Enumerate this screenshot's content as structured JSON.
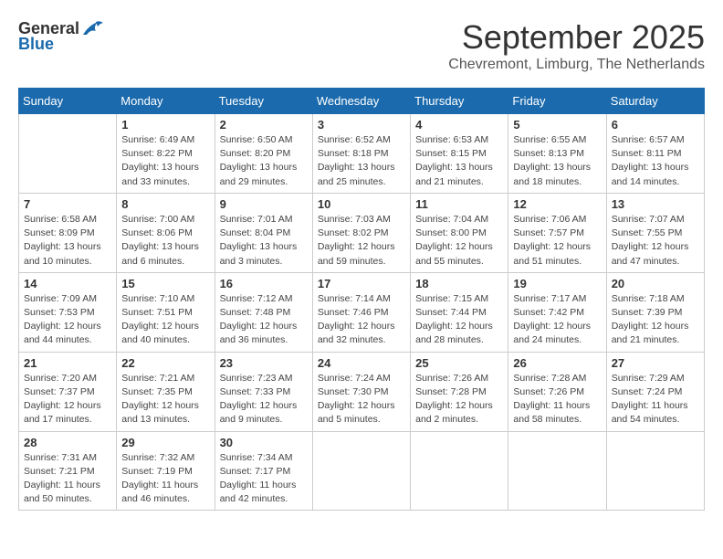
{
  "header": {
    "logo_general": "General",
    "logo_blue": "Blue",
    "title": "September 2025",
    "subtitle": "Chevremont, Limburg, The Netherlands"
  },
  "columns": [
    "Sunday",
    "Monday",
    "Tuesday",
    "Wednesday",
    "Thursday",
    "Friday",
    "Saturday"
  ],
  "weeks": [
    [
      {
        "day": "",
        "info": ""
      },
      {
        "day": "1",
        "info": "Sunrise: 6:49 AM\nSunset: 8:22 PM\nDaylight: 13 hours\nand 33 minutes."
      },
      {
        "day": "2",
        "info": "Sunrise: 6:50 AM\nSunset: 8:20 PM\nDaylight: 13 hours\nand 29 minutes."
      },
      {
        "day": "3",
        "info": "Sunrise: 6:52 AM\nSunset: 8:18 PM\nDaylight: 13 hours\nand 25 minutes."
      },
      {
        "day": "4",
        "info": "Sunrise: 6:53 AM\nSunset: 8:15 PM\nDaylight: 13 hours\nand 21 minutes."
      },
      {
        "day": "5",
        "info": "Sunrise: 6:55 AM\nSunset: 8:13 PM\nDaylight: 13 hours\nand 18 minutes."
      },
      {
        "day": "6",
        "info": "Sunrise: 6:57 AM\nSunset: 8:11 PM\nDaylight: 13 hours\nand 14 minutes."
      }
    ],
    [
      {
        "day": "7",
        "info": "Sunrise: 6:58 AM\nSunset: 8:09 PM\nDaylight: 13 hours\nand 10 minutes."
      },
      {
        "day": "8",
        "info": "Sunrise: 7:00 AM\nSunset: 8:06 PM\nDaylight: 13 hours\nand 6 minutes."
      },
      {
        "day": "9",
        "info": "Sunrise: 7:01 AM\nSunset: 8:04 PM\nDaylight: 13 hours\nand 3 minutes."
      },
      {
        "day": "10",
        "info": "Sunrise: 7:03 AM\nSunset: 8:02 PM\nDaylight: 12 hours\nand 59 minutes."
      },
      {
        "day": "11",
        "info": "Sunrise: 7:04 AM\nSunset: 8:00 PM\nDaylight: 12 hours\nand 55 minutes."
      },
      {
        "day": "12",
        "info": "Sunrise: 7:06 AM\nSunset: 7:57 PM\nDaylight: 12 hours\nand 51 minutes."
      },
      {
        "day": "13",
        "info": "Sunrise: 7:07 AM\nSunset: 7:55 PM\nDaylight: 12 hours\nand 47 minutes."
      }
    ],
    [
      {
        "day": "14",
        "info": "Sunrise: 7:09 AM\nSunset: 7:53 PM\nDaylight: 12 hours\nand 44 minutes."
      },
      {
        "day": "15",
        "info": "Sunrise: 7:10 AM\nSunset: 7:51 PM\nDaylight: 12 hours\nand 40 minutes."
      },
      {
        "day": "16",
        "info": "Sunrise: 7:12 AM\nSunset: 7:48 PM\nDaylight: 12 hours\nand 36 minutes."
      },
      {
        "day": "17",
        "info": "Sunrise: 7:14 AM\nSunset: 7:46 PM\nDaylight: 12 hours\nand 32 minutes."
      },
      {
        "day": "18",
        "info": "Sunrise: 7:15 AM\nSunset: 7:44 PM\nDaylight: 12 hours\nand 28 minutes."
      },
      {
        "day": "19",
        "info": "Sunrise: 7:17 AM\nSunset: 7:42 PM\nDaylight: 12 hours\nand 24 minutes."
      },
      {
        "day": "20",
        "info": "Sunrise: 7:18 AM\nSunset: 7:39 PM\nDaylight: 12 hours\nand 21 minutes."
      }
    ],
    [
      {
        "day": "21",
        "info": "Sunrise: 7:20 AM\nSunset: 7:37 PM\nDaylight: 12 hours\nand 17 minutes."
      },
      {
        "day": "22",
        "info": "Sunrise: 7:21 AM\nSunset: 7:35 PM\nDaylight: 12 hours\nand 13 minutes."
      },
      {
        "day": "23",
        "info": "Sunrise: 7:23 AM\nSunset: 7:33 PM\nDaylight: 12 hours\nand 9 minutes."
      },
      {
        "day": "24",
        "info": "Sunrise: 7:24 AM\nSunset: 7:30 PM\nDaylight: 12 hours\nand 5 minutes."
      },
      {
        "day": "25",
        "info": "Sunrise: 7:26 AM\nSunset: 7:28 PM\nDaylight: 12 hours\nand 2 minutes."
      },
      {
        "day": "26",
        "info": "Sunrise: 7:28 AM\nSunset: 7:26 PM\nDaylight: 11 hours\nand 58 minutes."
      },
      {
        "day": "27",
        "info": "Sunrise: 7:29 AM\nSunset: 7:24 PM\nDaylight: 11 hours\nand 54 minutes."
      }
    ],
    [
      {
        "day": "28",
        "info": "Sunrise: 7:31 AM\nSunset: 7:21 PM\nDaylight: 11 hours\nand 50 minutes."
      },
      {
        "day": "29",
        "info": "Sunrise: 7:32 AM\nSunset: 7:19 PM\nDaylight: 11 hours\nand 46 minutes."
      },
      {
        "day": "30",
        "info": "Sunrise: 7:34 AM\nSunset: 7:17 PM\nDaylight: 11 hours\nand 42 minutes."
      },
      {
        "day": "",
        "info": ""
      },
      {
        "day": "",
        "info": ""
      },
      {
        "day": "",
        "info": ""
      },
      {
        "day": "",
        "info": ""
      }
    ]
  ]
}
